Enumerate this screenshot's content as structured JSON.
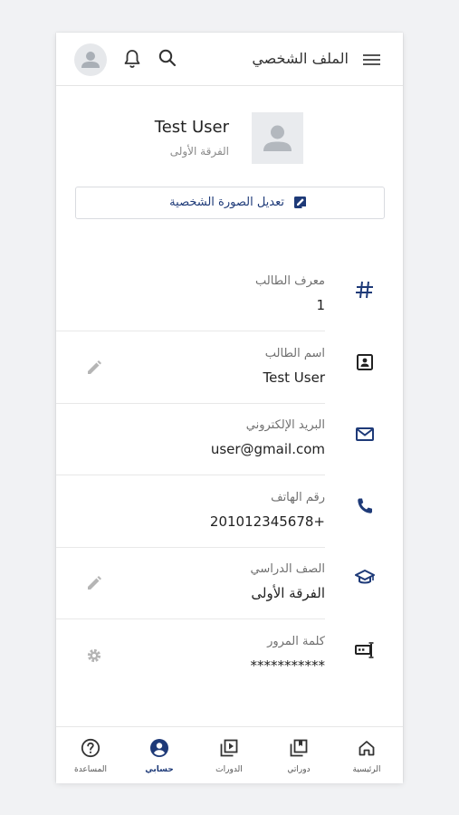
{
  "header": {
    "title": "الملف الشخصي"
  },
  "profile": {
    "name": "Test User",
    "group": "الفرقة الأولى",
    "edit_photo_label": "تعديل الصورة الشخصية"
  },
  "fields": [
    {
      "label": "معرف الطالب",
      "value": "1",
      "icon": "hash-icon"
    },
    {
      "label": "اسم الطالب",
      "value": "Test User",
      "icon": "contact-card-icon",
      "action_icon": "pencil-icon"
    },
    {
      "label": "البريد الإلكتروني",
      "value": "user@gmail.com",
      "icon": "mail-icon"
    },
    {
      "label": "رقم الهاتف",
      "value": "201012345678+",
      "icon": "phone-icon"
    },
    {
      "label": "الصف الدراسي",
      "value": "الفرقة الأولى",
      "icon": "graduation-cap-icon",
      "action_icon": "pencil-icon"
    },
    {
      "label": "كلمة المرور",
      "value": "***********",
      "icon": "password-icon",
      "action_icon": "gear-icon"
    }
  ],
  "bottom_nav": [
    {
      "label": "الرئيسية",
      "icon": "home-icon"
    },
    {
      "label": "دوراتي",
      "icon": "my-courses-icon"
    },
    {
      "label": "الدورات",
      "icon": "courses-icon"
    },
    {
      "label": "حسابي",
      "icon": "account-icon",
      "active": true
    },
    {
      "label": "المساعدة",
      "icon": "help-icon"
    }
  ],
  "colors": {
    "accent": "#1e3a78",
    "text": "#222222",
    "muted": "#707070",
    "background": "#f1f2f4"
  }
}
